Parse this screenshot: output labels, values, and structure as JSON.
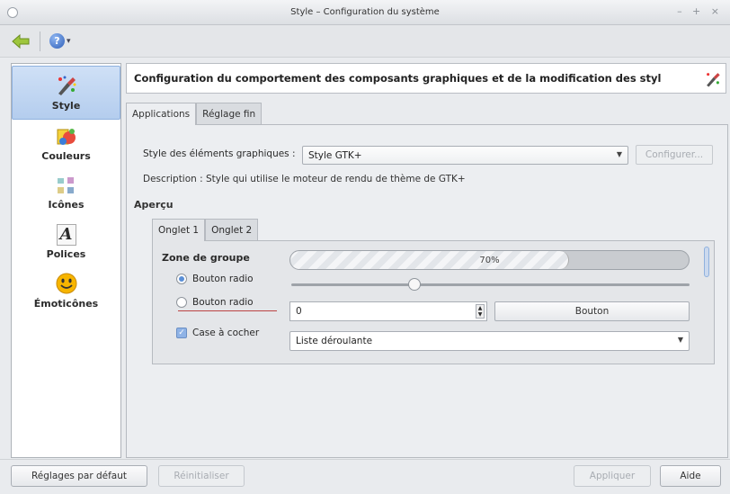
{
  "window": {
    "title": "Style – Configuration du système",
    "controls": "– + ×"
  },
  "toolbar": {
    "back_icon": "back-arrow-icon",
    "help_icon": "help-icon",
    "help_label": "?",
    "help_dropdown": "▾"
  },
  "sidebar": {
    "items": [
      {
        "label": "Style",
        "icon": "style-brush-icon",
        "active": true
      },
      {
        "label": "Couleurs",
        "icon": "colors-palette-icon",
        "active": false
      },
      {
        "label": "Icônes",
        "icon": "icons-icon",
        "active": false
      },
      {
        "label": "Polices",
        "icon": "fonts-icon",
        "active": false
      },
      {
        "label": "Émoticônes",
        "icon": "emoticons-smiley-icon",
        "active": false
      }
    ]
  },
  "main": {
    "header_title": "Configuration du comportement des composants graphiques et de la modification des styl",
    "tabs": [
      {
        "label": "Applications",
        "active": true
      },
      {
        "label": "Réglage fin",
        "active": false
      }
    ],
    "style_label": "Style des éléments graphiques :",
    "style_combo_value": "Style GTK+",
    "configure_button": "Configurer...",
    "description": "Description : Style qui utilise le moteur de rendu de thème de GTK+",
    "apercu_title": "Aperçu",
    "preview_tabs": [
      {
        "label": "Onglet 1",
        "active": true
      },
      {
        "label": "Onglet 2",
        "active": false
      }
    ],
    "preview": {
      "group_title": "Zone de groupe",
      "radio1_label": "Bouton radio",
      "radio1_checked": true,
      "radio2_label": "Bouton radio",
      "radio2_checked": false,
      "checkbox_label": "Case à cocher",
      "checkbox_checked": true,
      "progress_value": 0.7,
      "progress_text": "70%",
      "slider_value": 0.31,
      "spin_value": "0",
      "button_label": "Bouton",
      "dropdown_value": "Liste déroulante"
    }
  },
  "footer": {
    "defaults_button": "Réglages par défaut",
    "reset_button": "Réinitialiser",
    "apply_button": "Appliquer",
    "help_button": "Aide"
  },
  "colors": {
    "selection": "#b4cdee",
    "accent": "#5b8fd6"
  }
}
